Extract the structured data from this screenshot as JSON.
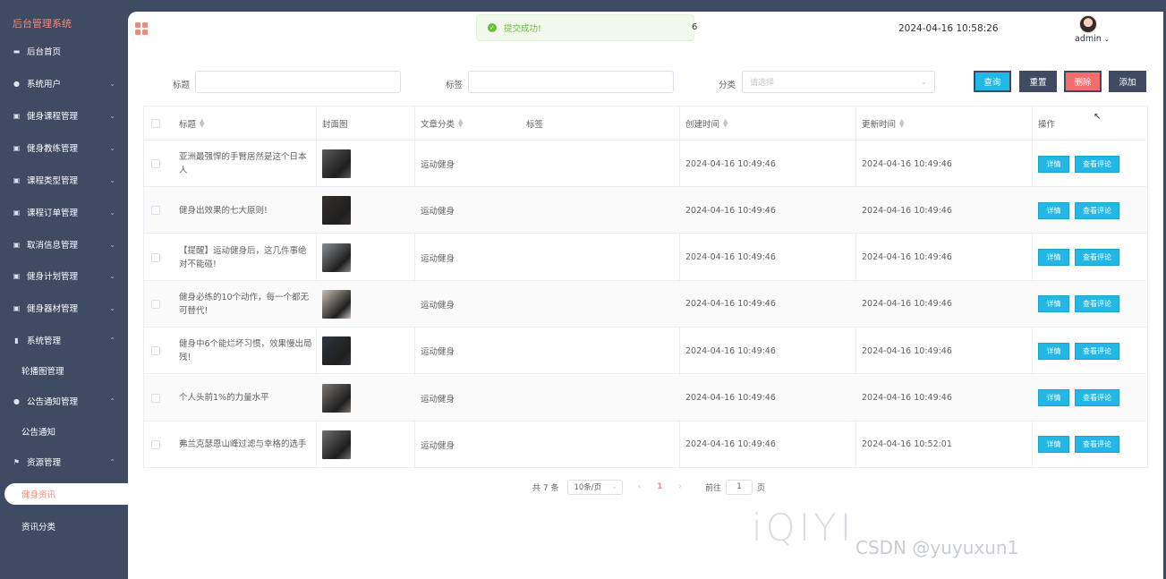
{
  "sidebar": {
    "brand": "后台管理系统",
    "items": [
      {
        "label": "后台首页",
        "icon": "monitor-icon",
        "arrow": ""
      },
      {
        "label": "系统用户",
        "icon": "user-icon",
        "arrow": "⌄"
      },
      {
        "label": "健身课程管理",
        "icon": "list-icon",
        "arrow": "⌄"
      },
      {
        "label": "健身教练管理",
        "icon": "list-icon",
        "arrow": "⌄"
      },
      {
        "label": "课程类型管理",
        "icon": "list-icon",
        "arrow": "⌄"
      },
      {
        "label": "课程订单管理",
        "icon": "list-icon",
        "arrow": "⌄"
      },
      {
        "label": "取消信息管理",
        "icon": "list-icon",
        "arrow": "⌄"
      },
      {
        "label": "健身计划管理",
        "icon": "list-icon",
        "arrow": "⌄"
      },
      {
        "label": "健身器材管理",
        "icon": "list-icon",
        "arrow": "⌄"
      },
      {
        "label": "系统管理",
        "icon": "bar-chart-icon",
        "arrow": "⌃"
      },
      {
        "label": "公告通知管理",
        "icon": "info-icon",
        "arrow": "⌃"
      },
      {
        "label": "资源管理",
        "icon": "flag-icon",
        "arrow": "⌃"
      }
    ],
    "subitems": {
      "carousel": "轮播图管理",
      "notice": "公告通知",
      "fitness_news": "健身资讯",
      "news_category": "资讯分类"
    }
  },
  "header": {
    "toast": "提交成功!",
    "toast_tail": "6",
    "datetime": "2024-04-16 10:58:26",
    "username": "admin"
  },
  "search": {
    "title_label": "标题",
    "tag_label": "标签",
    "category_label": "分类",
    "category_placeholder": "请选择",
    "buttons": {
      "query": "查询",
      "reset": "重置",
      "delete": "删除",
      "add": "添加"
    }
  },
  "colors": {
    "query": "#23b7e5",
    "reset": "#3f4a63",
    "delete": "#f56c6c",
    "add": "#3f4a63"
  },
  "table": {
    "headers": {
      "title": "标题",
      "cover": "封面图",
      "category": "文章分类",
      "tags": "标签",
      "created": "创建时间",
      "updated": "更新时间",
      "actions": "操作"
    },
    "rows": [
      {
        "title": "亚洲最强悍的手臂居然是这个日本人",
        "category": "运动健身",
        "created": "2024-04-16 10:49:46",
        "updated": "2024-04-16 10:49:46",
        "thumb": "#5a5a5a"
      },
      {
        "title": "健身出效果的七大原则!",
        "category": "运动健身",
        "created": "2024-04-16 10:49:46",
        "updated": "2024-04-16 10:49:46",
        "thumb": "#3a2e2e"
      },
      {
        "title": "【提醒】运动健身后，这几件事绝对不能碰!",
        "category": "运动健身",
        "created": "2024-04-16 10:49:46",
        "updated": "2024-04-16 10:49:46",
        "thumb": "#8a8e94"
      },
      {
        "title": "健身必练的10个动作，每一个都无可替代!",
        "category": "运动健身",
        "created": "2024-04-16 10:49:46",
        "updated": "2024-04-16 10:49:46",
        "thumb": "#c9bfb3"
      },
      {
        "title": "健身中6个能烂坏习惯，效果慢出局残!",
        "category": "运动健身",
        "created": "2024-04-16 10:49:46",
        "updated": "2024-04-16 10:49:46",
        "thumb": "#2f3640"
      },
      {
        "title": "个人头前1%的力量水平",
        "category": "运动健身",
        "created": "2024-04-16 10:49:46",
        "updated": "2024-04-16 10:49:46",
        "thumb": "#7d7570"
      },
      {
        "title": "弗兰克瑟恩山峰过滤与幸格的选手",
        "category": "运动健身",
        "created": "2024-04-16 10:49:46",
        "updated": "2024-04-16 10:52:01",
        "thumb": "#6e6e6e"
      }
    ],
    "action_labels": {
      "detail": "详情",
      "comments": "查看评论"
    }
  },
  "pagination": {
    "total": "共 7 条",
    "page_size": "10条/页",
    "prev": "‹",
    "current": "1",
    "next": "›",
    "goto_prefix": "前往",
    "goto_value": "1",
    "goto_suffix": "页"
  },
  "watermark": {
    "iqiyi": "iQIYI",
    "csdn": "CSDN @yuyuxun1"
  }
}
